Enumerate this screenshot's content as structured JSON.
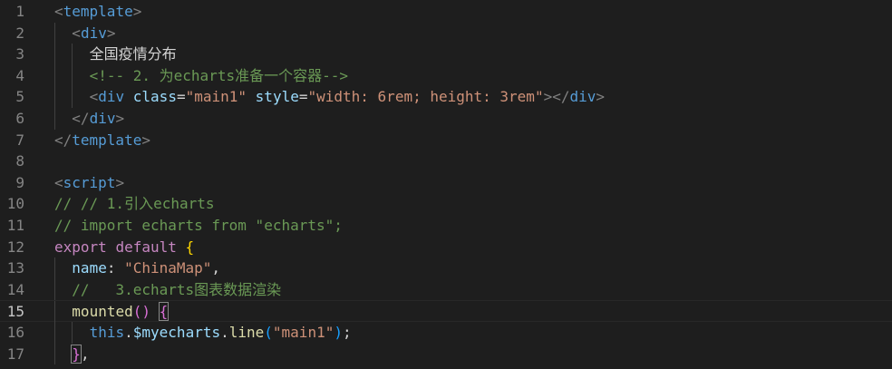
{
  "editor": {
    "active_line": 15,
    "lines": [
      {
        "n": "1",
        "indent": 0,
        "tokens": [
          [
            "<",
            "punct"
          ],
          [
            "template",
            "tag"
          ],
          [
            ">",
            "punct"
          ]
        ]
      },
      {
        "n": "2",
        "indent": 1,
        "tokens": [
          [
            "<",
            "punct"
          ],
          [
            "div",
            "tag"
          ],
          [
            ">",
            "punct"
          ]
        ]
      },
      {
        "n": "3",
        "indent": 2,
        "tokens": [
          [
            "全国疫情分布",
            "text"
          ]
        ]
      },
      {
        "n": "4",
        "indent": 2,
        "tokens": [
          [
            "<!-- 2. 为echarts准备一个容器-->",
            "comment"
          ]
        ]
      },
      {
        "n": "5",
        "indent": 2,
        "tokens": [
          [
            "<",
            "punct"
          ],
          [
            "div",
            "tag"
          ],
          [
            " ",
            "text"
          ],
          [
            "class",
            "attr"
          ],
          [
            "=",
            "text"
          ],
          [
            "\"main1\"",
            "str"
          ],
          [
            " ",
            "text"
          ],
          [
            "style",
            "attr"
          ],
          [
            "=",
            "text"
          ],
          [
            "\"width: 6rem; height: 3rem\"",
            "str"
          ],
          [
            ">",
            "punct"
          ],
          [
            "</",
            "punct"
          ],
          [
            "div",
            "tag"
          ],
          [
            ">",
            "punct"
          ]
        ]
      },
      {
        "n": "6",
        "indent": 1,
        "tokens": [
          [
            "</",
            "punct"
          ],
          [
            "div",
            "tag"
          ],
          [
            ">",
            "punct"
          ]
        ]
      },
      {
        "n": "7",
        "indent": 0,
        "tokens": [
          [
            "</",
            "punct"
          ],
          [
            "template",
            "tag"
          ],
          [
            ">",
            "punct"
          ]
        ]
      },
      {
        "n": "8",
        "indent": 0,
        "tokens": []
      },
      {
        "n": "9",
        "indent": 0,
        "tokens": [
          [
            "<",
            "punct"
          ],
          [
            "script",
            "tag"
          ],
          [
            ">",
            "punct"
          ]
        ]
      },
      {
        "n": "10",
        "indent": 0,
        "tokens": [
          [
            "// // 1.引入echarts",
            "comment"
          ]
        ]
      },
      {
        "n": "11",
        "indent": 0,
        "tokens": [
          [
            "// import echarts from \"echarts\";",
            "comment"
          ]
        ]
      },
      {
        "n": "12",
        "indent": 0,
        "tokens": [
          [
            "export",
            "kw"
          ],
          [
            " ",
            "text"
          ],
          [
            "default",
            "kw"
          ],
          [
            " ",
            "text"
          ],
          [
            "{",
            "brace1"
          ]
        ]
      },
      {
        "n": "13",
        "indent": 1,
        "tokens": [
          [
            "name",
            "prop"
          ],
          [
            ": ",
            "text"
          ],
          [
            "\"ChinaMap\"",
            "str"
          ],
          [
            ",",
            "text"
          ]
        ]
      },
      {
        "n": "14",
        "indent": 1,
        "tokens": [
          [
            "//   3.echarts图表数据渲染",
            "comment"
          ]
        ]
      },
      {
        "n": "15",
        "indent": 1,
        "tokens": [
          [
            "mounted",
            "fn"
          ],
          [
            "()",
            "brace2"
          ],
          [
            " ",
            "text"
          ],
          [
            "{",
            "brace2 t-match"
          ]
        ]
      },
      {
        "n": "16",
        "indent": 2,
        "tokens": [
          [
            "this",
            "this"
          ],
          [
            ".",
            "text"
          ],
          [
            "$myecharts",
            "var"
          ],
          [
            ".",
            "text"
          ],
          [
            "line",
            "fn"
          ],
          [
            "(",
            "brace3"
          ],
          [
            "\"main1\"",
            "str"
          ],
          [
            ")",
            "brace3"
          ],
          [
            ";",
            "text"
          ]
        ]
      },
      {
        "n": "17",
        "indent": 1,
        "tokens": [
          [
            "}",
            "brace2 t-match"
          ],
          [
            ",",
            "text"
          ]
        ]
      }
    ]
  }
}
